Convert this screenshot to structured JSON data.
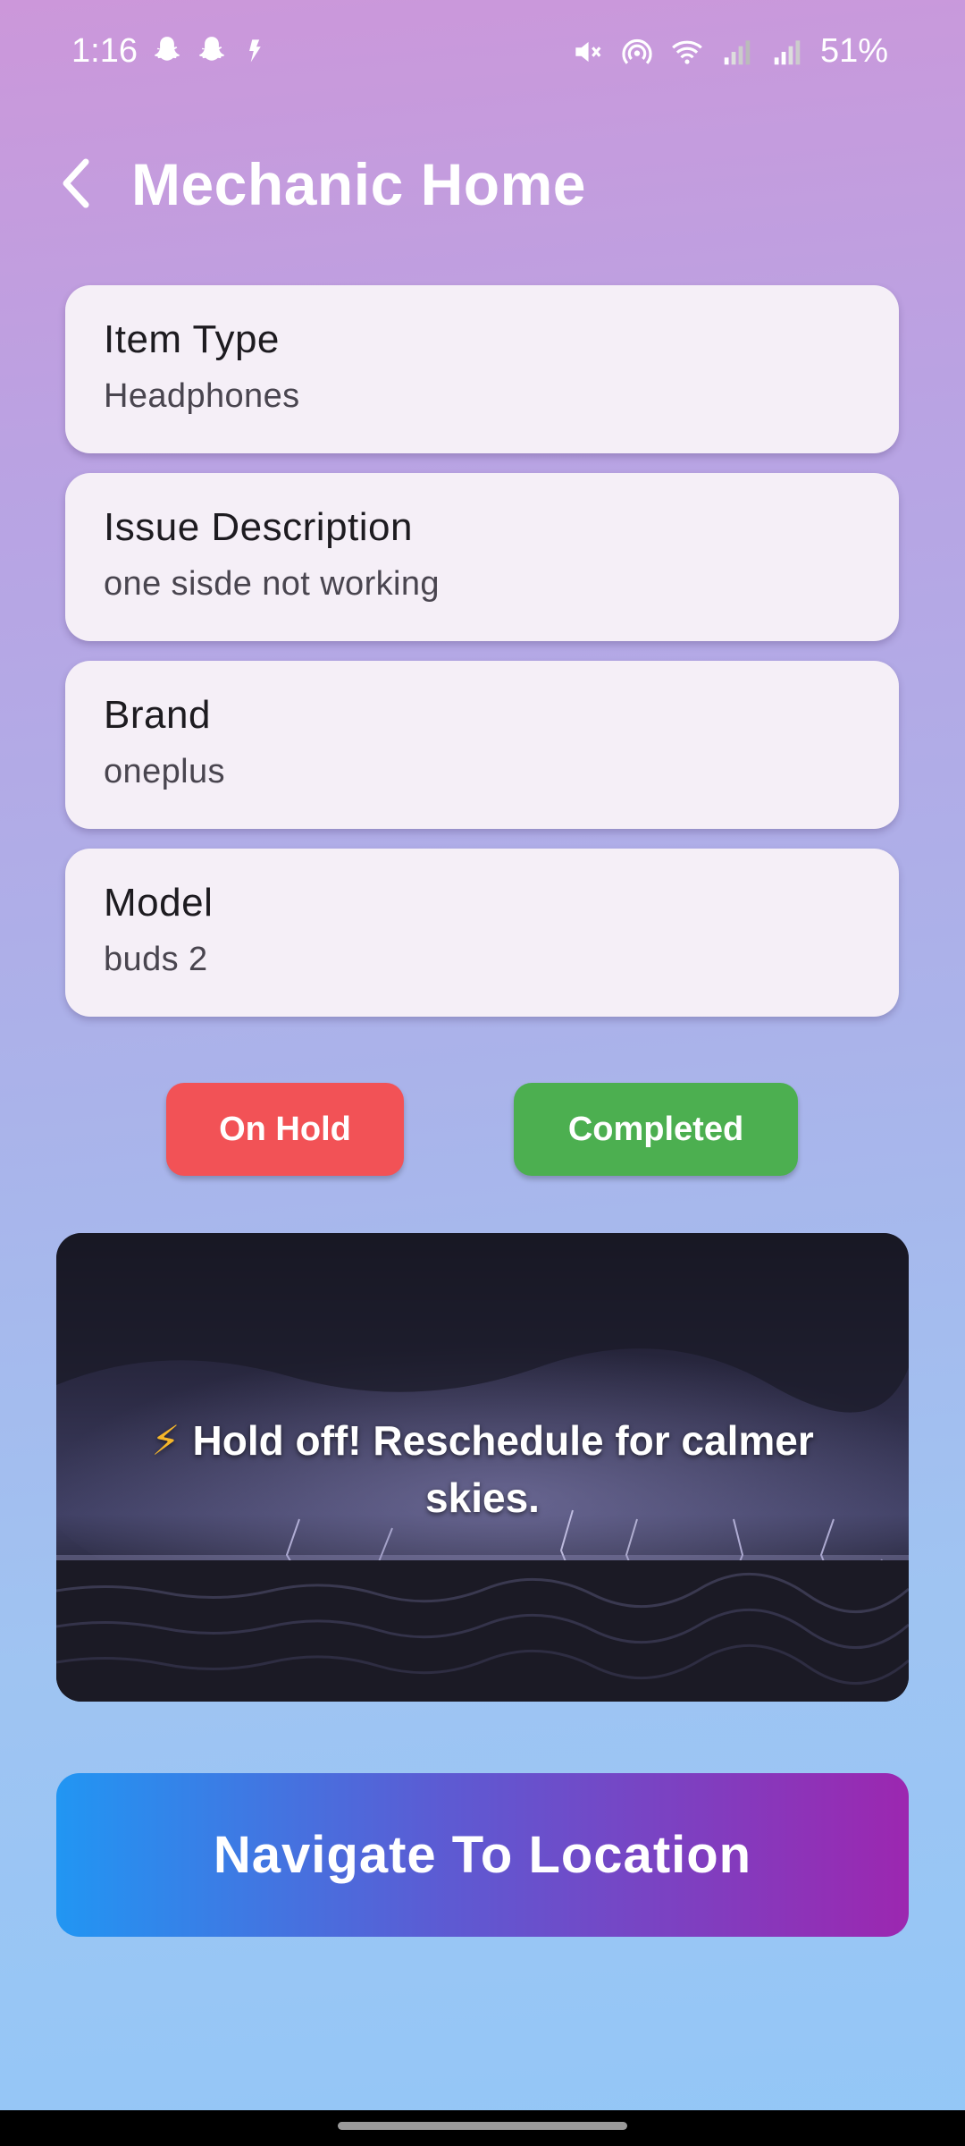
{
  "status_bar": {
    "time": "1:16",
    "battery": "51%",
    "left_icons": [
      "snapchat-icon",
      "snapchat-icon",
      "app-notification-icon"
    ],
    "right_icons": [
      "mute-icon",
      "hotspot-icon",
      "wifi-icon",
      "signal-icon",
      "signal-icon"
    ]
  },
  "header": {
    "title": "Mechanic Home",
    "back_icon": "chevron-left-icon"
  },
  "cards": [
    {
      "label": "Item Type",
      "value": "Headphones"
    },
    {
      "label": "Issue Description",
      "value": "one sisde not working"
    },
    {
      "label": "Brand",
      "value": "oneplus"
    },
    {
      "label": "Model",
      "value": "buds 2"
    }
  ],
  "actions": {
    "hold_label": "On Hold",
    "hold_color": "#f25256",
    "completed_label": "Completed",
    "completed_color": "#4caf50"
  },
  "weather": {
    "icon": "lightning-icon",
    "message": "Hold off! Reschedule for calmer skies."
  },
  "navigate": {
    "label": "Navigate To Location",
    "gradient": [
      "#2196f3",
      "#9c27b0"
    ]
  }
}
